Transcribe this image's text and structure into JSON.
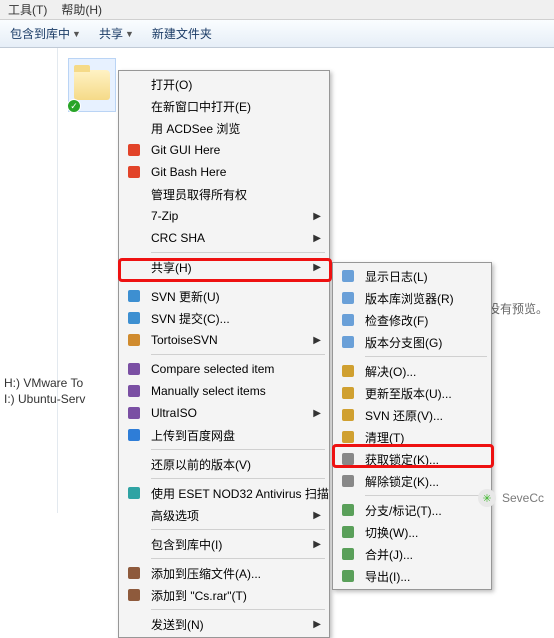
{
  "menubar": {
    "tools": "工具(T)",
    "help": "帮助(H)"
  },
  "toolbar": {
    "include": "包含到库中",
    "share": "共享",
    "newfolder": "新建文件夹"
  },
  "sidebar_drives": {
    "h": "H:) VMware To",
    "i": "I:) Ubuntu-Serv"
  },
  "right_pane_hint": "没有预览。",
  "watermark": "SeveCc",
  "main_menu": [
    {
      "label": "打开(O)",
      "ico": ""
    },
    {
      "label": "在新窗口中打开(E)",
      "ico": ""
    },
    {
      "label": "用 ACDSee 浏览",
      "ico": ""
    },
    {
      "label": "Git GUI Here",
      "ico": "git"
    },
    {
      "label": "Git Bash Here",
      "ico": "git"
    },
    {
      "label": "管理员取得所有权",
      "ico": ""
    },
    {
      "label": "7-Zip",
      "ico": "",
      "sub": true
    },
    {
      "label": "CRC SHA",
      "ico": "",
      "sub": true
    },
    {
      "sep": true
    },
    {
      "label": "共享(H)",
      "ico": "",
      "sub": true
    },
    {
      "sep": true
    },
    {
      "label": "SVN 更新(U)",
      "ico": "svn"
    },
    {
      "label": "SVN 提交(C)...",
      "ico": "svn"
    },
    {
      "label": "TortoiseSVN",
      "ico": "tsvn",
      "sub": true
    },
    {
      "sep": true
    },
    {
      "label": "Compare selected item",
      "ico": "ult"
    },
    {
      "label": "Manually select items",
      "ico": "ult"
    },
    {
      "label": "UltraISO",
      "ico": "ult",
      "sub": true
    },
    {
      "label": "上传到百度网盘",
      "ico": "baidu"
    },
    {
      "sep": true
    },
    {
      "label": "还原以前的版本(V)",
      "ico": ""
    },
    {
      "sep": true
    },
    {
      "label": "使用 ESET NOD32 Antivirus 扫描",
      "ico": "eset"
    },
    {
      "label": "高级选项",
      "ico": "",
      "sub": true
    },
    {
      "sep": true
    },
    {
      "label": "包含到库中(I)",
      "ico": "",
      "sub": true
    },
    {
      "sep": true
    },
    {
      "label": "添加到压缩文件(A)...",
      "ico": "rar"
    },
    {
      "label": "添加到 \"Cs.rar\"(T)",
      "ico": "rar"
    },
    {
      "sep": true
    },
    {
      "label": "发送到(N)",
      "ico": "",
      "sub": true
    }
  ],
  "sub_menu": [
    {
      "label": "显示日志(L)",
      "ico": "log"
    },
    {
      "label": "版本库浏览器(R)",
      "ico": "browse"
    },
    {
      "label": "检查修改(F)",
      "ico": "check"
    },
    {
      "label": "版本分支图(G)",
      "ico": "graph"
    },
    {
      "sep": true
    },
    {
      "label": "解决(O)...",
      "ico": "resolve"
    },
    {
      "label": "更新至版本(U)...",
      "ico": "update"
    },
    {
      "label": "SVN 还原(V)...",
      "ico": "revert"
    },
    {
      "label": "清理(T)",
      "ico": "clean"
    },
    {
      "label": "获取锁定(K)...",
      "ico": "lock"
    },
    {
      "label": "解除锁定(K)...",
      "ico": "unlock"
    },
    {
      "sep": true
    },
    {
      "label": "分支/标记(T)...",
      "ico": "branch"
    },
    {
      "label": "切换(W)...",
      "ico": "switch"
    },
    {
      "label": "合并(J)...",
      "ico": "merge"
    },
    {
      "label": "导出(I)...",
      "ico": "export"
    }
  ]
}
